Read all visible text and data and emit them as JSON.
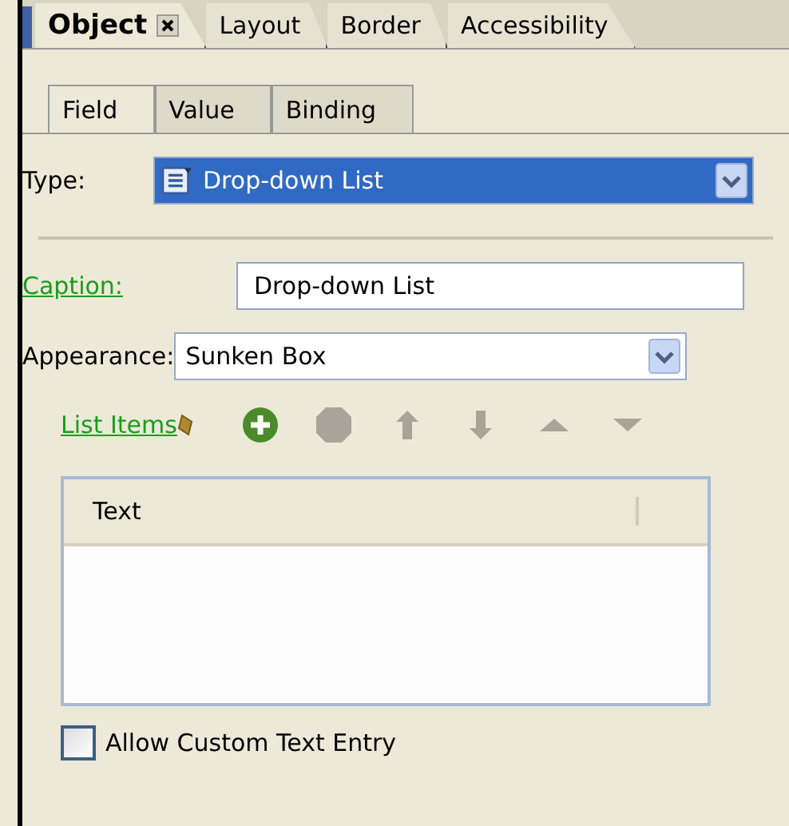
{
  "tabs": [
    {
      "label": "Object",
      "selected": true,
      "closable": true
    },
    {
      "label": "Layout",
      "selected": false,
      "closable": false
    },
    {
      "label": "Border",
      "selected": false,
      "closable": false
    },
    {
      "label": "Accessibility",
      "selected": false,
      "closable": false
    }
  ],
  "subtabs": [
    {
      "label": "Field",
      "selected": true
    },
    {
      "label": "Value",
      "selected": false
    },
    {
      "label": "Binding",
      "selected": false
    }
  ],
  "type": {
    "label": "Type:",
    "value": "Drop-down List",
    "selected": true
  },
  "caption": {
    "label": "Caption:",
    "value": "Drop-down List"
  },
  "appearance": {
    "label": "Appearance:",
    "value": "Sunken Box"
  },
  "list_items": {
    "label": "List Items",
    "toolbar": [
      {
        "kind": "add",
        "disabled": false
      },
      {
        "kind": "remove",
        "disabled": true
      },
      {
        "kind": "up",
        "disabled": true
      },
      {
        "kind": "down",
        "disabled": true
      },
      {
        "kind": "first",
        "disabled": true
      },
      {
        "kind": "last",
        "disabled": true
      }
    ]
  },
  "table": {
    "columns": [
      "Text"
    ]
  },
  "allow_custom": {
    "label": "Allow Custom Text Entry",
    "checked": false
  }
}
